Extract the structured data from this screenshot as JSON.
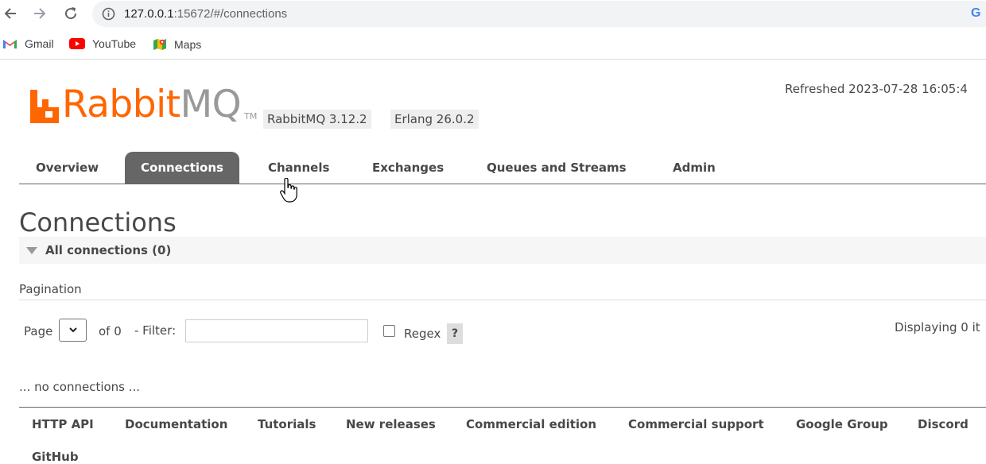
{
  "browser": {
    "url_host": "127.0.0.1",
    "url_path": ":15672/#/connections",
    "bookmarks": [
      {
        "label": "Gmail",
        "icon": "gmail-icon"
      },
      {
        "label": "YouTube",
        "icon": "youtube-icon"
      },
      {
        "label": "Maps",
        "icon": "maps-icon"
      }
    ],
    "google_icon": "G"
  },
  "header": {
    "logo_rabbit": "Rabbit",
    "logo_mq": "MQ",
    "logo_tm": "TM",
    "rabbitmq_version": "RabbitMQ 3.12.2",
    "erlang_version": "Erlang 26.0.2",
    "refreshed": "Refreshed 2023-07-28 16:05:4"
  },
  "tabs": [
    {
      "label": "Overview",
      "active": false
    },
    {
      "label": "Connections",
      "active": true
    },
    {
      "label": "Channels",
      "active": false
    },
    {
      "label": "Exchanges",
      "active": false
    },
    {
      "label": "Queues and Streams",
      "active": false
    },
    {
      "label": "Admin",
      "active": false
    }
  ],
  "main": {
    "title": "Connections",
    "section_label": "All connections (0)",
    "pagination_label": "Pagination",
    "page_label": "Page",
    "of_label": "of 0",
    "filter_label": "- Filter:",
    "filter_value": "",
    "regex_label": "Regex",
    "regex_checked": false,
    "help_label": "?",
    "displaying": "Displaying 0 it",
    "empty_message": "... no connections ..."
  },
  "footer": {
    "links": [
      "HTTP API",
      "Documentation",
      "Tutorials",
      "New releases",
      "Commercial edition",
      "Commercial support",
      "Google Group",
      "Discord",
      "GitHub"
    ]
  },
  "colors": {
    "brand_orange": "#ff6600",
    "tab_active_bg": "#666666",
    "text": "#484848"
  }
}
